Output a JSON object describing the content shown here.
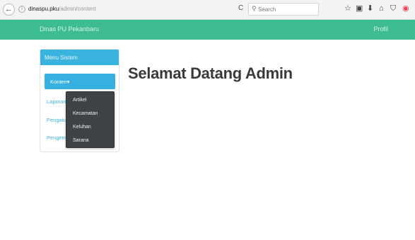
{
  "browser": {
    "url_host": "dinaspu.pku",
    "url_path": "/admin/content",
    "search_placeholder": "Search",
    "back_glyph": "←",
    "info_glyph": "i",
    "reload_glyph": "C",
    "search_glyph": "⚲",
    "toolbar_icons": [
      {
        "name": "star-icon",
        "glyph": "☆"
      },
      {
        "name": "clipboard-icon",
        "glyph": "▣"
      },
      {
        "name": "download-icon",
        "glyph": "⬇"
      },
      {
        "name": "home-icon",
        "glyph": "⌂"
      },
      {
        "name": "shield-icon",
        "glyph": "⛉"
      },
      {
        "name": "pocket-icon",
        "glyph": "◉"
      }
    ]
  },
  "navbar": {
    "brand": "Dinas PU Pekanbaru",
    "profile": "Profil",
    "bg_color": "#3dbc8f"
  },
  "sidebar": {
    "header": "Menu Sistem",
    "konten_label": "Konten▾",
    "links": [
      "Laporan",
      "Pengatur",
      "Pengem"
    ],
    "accent_color": "#3ab4df"
  },
  "dropdown": {
    "items": [
      "Artikel",
      "Kecamatan",
      "Keluhan",
      "Sarana"
    ]
  },
  "main": {
    "heading": "Selamat Datang Admin"
  }
}
